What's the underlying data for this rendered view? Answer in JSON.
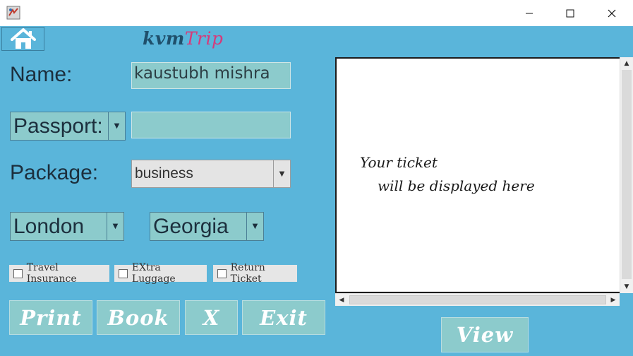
{
  "window": {
    "minimize_glyph": "—",
    "maximize_glyph": "☐",
    "close_glyph": "✕"
  },
  "header": {
    "brand_part1": "kvm",
    "brand_part2": "Trip",
    "home_icon": "home-icon"
  },
  "form": {
    "name_label": "Name:",
    "name_value": "kaustubh mishra",
    "passport_label": "Passport:",
    "passport_value": "",
    "package_label": "Package:",
    "package_value": "business",
    "from_city": "London",
    "to_city": "Georgia"
  },
  "options": {
    "travel_insurance": "Travel Insurance",
    "extra_luggage": "EXtra Luggage",
    "return_ticket": "Return Ticket"
  },
  "buttons": {
    "print": "Print",
    "book": "Book",
    "clear": "X",
    "exit": "Exit",
    "view": "View"
  },
  "ticket": {
    "line1": "Your ticket",
    "line2": "will be displayed here"
  },
  "colors": {
    "panel_bg": "#5ab5da",
    "field_bg": "#8ccbcc",
    "brand_dark": "#1f4f6b",
    "brand_pink": "#d63a7a"
  }
}
